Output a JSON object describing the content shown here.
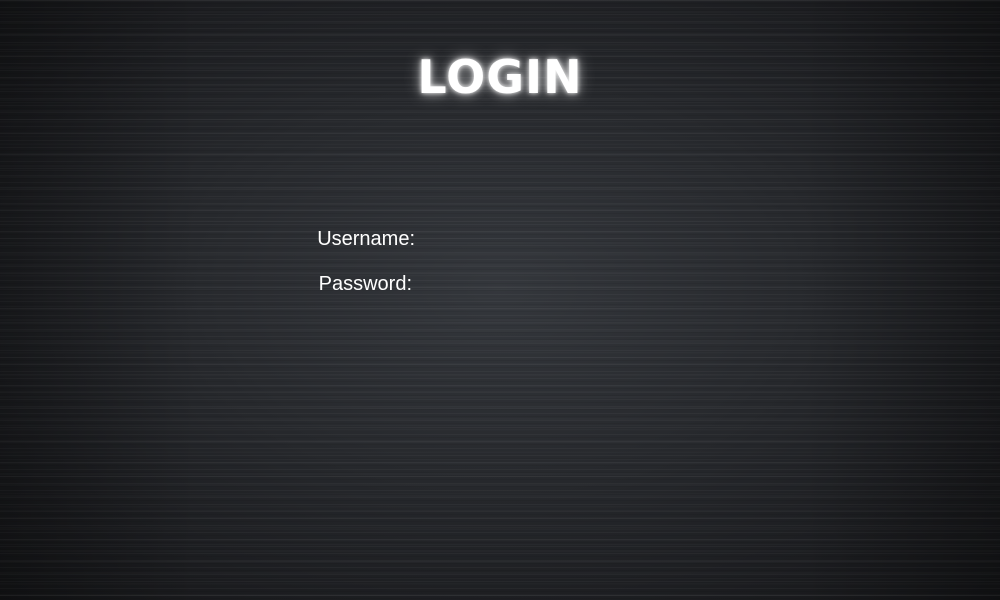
{
  "page": {
    "title": "LOGIN"
  },
  "form": {
    "username": {
      "label": "Username:",
      "value": ""
    },
    "password": {
      "label": "Password:",
      "value": ""
    }
  },
  "colors": {
    "background": "#26282c",
    "text": "#ffffff",
    "title_glow": "#ffffff"
  }
}
